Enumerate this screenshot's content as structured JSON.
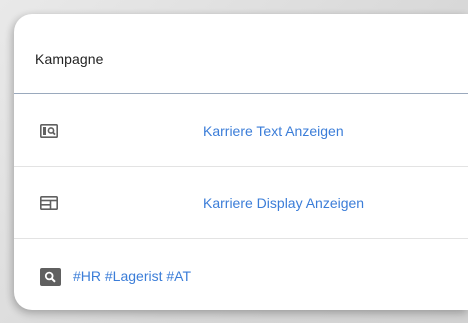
{
  "table": {
    "header": {
      "title": "Kampagne"
    },
    "rows": [
      {
        "icon": "text-ad-search-icon",
        "label": "Karriere Text Anzeigen"
      },
      {
        "icon": "display-ad-layout-icon",
        "label": "Karriere Display Anzeigen"
      }
    ],
    "keyword_row": {
      "icon": "search-icon",
      "label": "#HR #Lagerist #AT"
    }
  },
  "colors": {
    "link": "#3b7dd8",
    "icon": "#606060",
    "header_divider": "#9aa9bd"
  }
}
